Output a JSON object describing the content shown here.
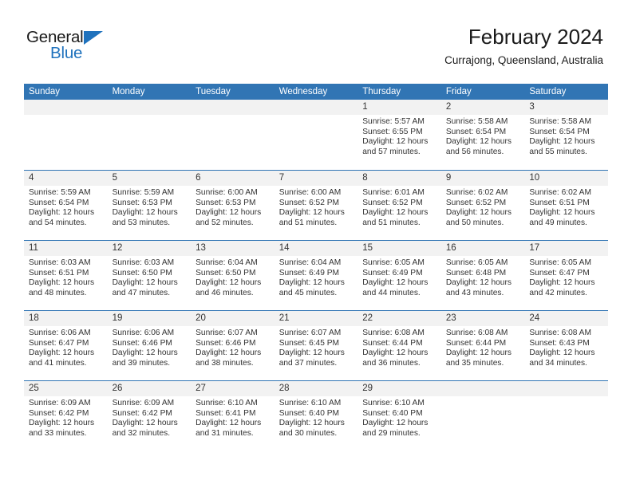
{
  "brand": {
    "name_top": "General",
    "name_bottom": "Blue"
  },
  "header": {
    "title": "February 2024",
    "subtitle": "Currajong, Queensland, Australia"
  },
  "colors": {
    "header_blue": "#3175b4",
    "brand_blue": "#1f72bd",
    "day_band_gray": "#f2f2f2",
    "text": "#333333"
  },
  "calendar": {
    "weekday_headers": [
      "Sunday",
      "Monday",
      "Tuesday",
      "Wednesday",
      "Thursday",
      "Friday",
      "Saturday"
    ],
    "weeks": [
      [
        {
          "day": "",
          "empty": true
        },
        {
          "day": "",
          "empty": true
        },
        {
          "day": "",
          "empty": true
        },
        {
          "day": "",
          "empty": true
        },
        {
          "day": "1",
          "sunrise": "Sunrise: 5:57 AM",
          "sunset": "Sunset: 6:55 PM",
          "daylight_1": "Daylight: 12 hours",
          "daylight_2": "and 57 minutes."
        },
        {
          "day": "2",
          "sunrise": "Sunrise: 5:58 AM",
          "sunset": "Sunset: 6:54 PM",
          "daylight_1": "Daylight: 12 hours",
          "daylight_2": "and 56 minutes."
        },
        {
          "day": "3",
          "sunrise": "Sunrise: 5:58 AM",
          "sunset": "Sunset: 6:54 PM",
          "daylight_1": "Daylight: 12 hours",
          "daylight_2": "and 55 minutes."
        }
      ],
      [
        {
          "day": "4",
          "sunrise": "Sunrise: 5:59 AM",
          "sunset": "Sunset: 6:54 PM",
          "daylight_1": "Daylight: 12 hours",
          "daylight_2": "and 54 minutes."
        },
        {
          "day": "5",
          "sunrise": "Sunrise: 5:59 AM",
          "sunset": "Sunset: 6:53 PM",
          "daylight_1": "Daylight: 12 hours",
          "daylight_2": "and 53 minutes."
        },
        {
          "day": "6",
          "sunrise": "Sunrise: 6:00 AM",
          "sunset": "Sunset: 6:53 PM",
          "daylight_1": "Daylight: 12 hours",
          "daylight_2": "and 52 minutes."
        },
        {
          "day": "7",
          "sunrise": "Sunrise: 6:00 AM",
          "sunset": "Sunset: 6:52 PM",
          "daylight_1": "Daylight: 12 hours",
          "daylight_2": "and 51 minutes."
        },
        {
          "day": "8",
          "sunrise": "Sunrise: 6:01 AM",
          "sunset": "Sunset: 6:52 PM",
          "daylight_1": "Daylight: 12 hours",
          "daylight_2": "and 51 minutes."
        },
        {
          "day": "9",
          "sunrise": "Sunrise: 6:02 AM",
          "sunset": "Sunset: 6:52 PM",
          "daylight_1": "Daylight: 12 hours",
          "daylight_2": "and 50 minutes."
        },
        {
          "day": "10",
          "sunrise": "Sunrise: 6:02 AM",
          "sunset": "Sunset: 6:51 PM",
          "daylight_1": "Daylight: 12 hours",
          "daylight_2": "and 49 minutes."
        }
      ],
      [
        {
          "day": "11",
          "sunrise": "Sunrise: 6:03 AM",
          "sunset": "Sunset: 6:51 PM",
          "daylight_1": "Daylight: 12 hours",
          "daylight_2": "and 48 minutes."
        },
        {
          "day": "12",
          "sunrise": "Sunrise: 6:03 AM",
          "sunset": "Sunset: 6:50 PM",
          "daylight_1": "Daylight: 12 hours",
          "daylight_2": "and 47 minutes."
        },
        {
          "day": "13",
          "sunrise": "Sunrise: 6:04 AM",
          "sunset": "Sunset: 6:50 PM",
          "daylight_1": "Daylight: 12 hours",
          "daylight_2": "and 46 minutes."
        },
        {
          "day": "14",
          "sunrise": "Sunrise: 6:04 AM",
          "sunset": "Sunset: 6:49 PM",
          "daylight_1": "Daylight: 12 hours",
          "daylight_2": "and 45 minutes."
        },
        {
          "day": "15",
          "sunrise": "Sunrise: 6:05 AM",
          "sunset": "Sunset: 6:49 PM",
          "daylight_1": "Daylight: 12 hours",
          "daylight_2": "and 44 minutes."
        },
        {
          "day": "16",
          "sunrise": "Sunrise: 6:05 AM",
          "sunset": "Sunset: 6:48 PM",
          "daylight_1": "Daylight: 12 hours",
          "daylight_2": "and 43 minutes."
        },
        {
          "day": "17",
          "sunrise": "Sunrise: 6:05 AM",
          "sunset": "Sunset: 6:47 PM",
          "daylight_1": "Daylight: 12 hours",
          "daylight_2": "and 42 minutes."
        }
      ],
      [
        {
          "day": "18",
          "sunrise": "Sunrise: 6:06 AM",
          "sunset": "Sunset: 6:47 PM",
          "daylight_1": "Daylight: 12 hours",
          "daylight_2": "and 41 minutes."
        },
        {
          "day": "19",
          "sunrise": "Sunrise: 6:06 AM",
          "sunset": "Sunset: 6:46 PM",
          "daylight_1": "Daylight: 12 hours",
          "daylight_2": "and 39 minutes."
        },
        {
          "day": "20",
          "sunrise": "Sunrise: 6:07 AM",
          "sunset": "Sunset: 6:46 PM",
          "daylight_1": "Daylight: 12 hours",
          "daylight_2": "and 38 minutes."
        },
        {
          "day": "21",
          "sunrise": "Sunrise: 6:07 AM",
          "sunset": "Sunset: 6:45 PM",
          "daylight_1": "Daylight: 12 hours",
          "daylight_2": "and 37 minutes."
        },
        {
          "day": "22",
          "sunrise": "Sunrise: 6:08 AM",
          "sunset": "Sunset: 6:44 PM",
          "daylight_1": "Daylight: 12 hours",
          "daylight_2": "and 36 minutes."
        },
        {
          "day": "23",
          "sunrise": "Sunrise: 6:08 AM",
          "sunset": "Sunset: 6:44 PM",
          "daylight_1": "Daylight: 12 hours",
          "daylight_2": "and 35 minutes."
        },
        {
          "day": "24",
          "sunrise": "Sunrise: 6:08 AM",
          "sunset": "Sunset: 6:43 PM",
          "daylight_1": "Daylight: 12 hours",
          "daylight_2": "and 34 minutes."
        }
      ],
      [
        {
          "day": "25",
          "sunrise": "Sunrise: 6:09 AM",
          "sunset": "Sunset: 6:42 PM",
          "daylight_1": "Daylight: 12 hours",
          "daylight_2": "and 33 minutes."
        },
        {
          "day": "26",
          "sunrise": "Sunrise: 6:09 AM",
          "sunset": "Sunset: 6:42 PM",
          "daylight_1": "Daylight: 12 hours",
          "daylight_2": "and 32 minutes."
        },
        {
          "day": "27",
          "sunrise": "Sunrise: 6:10 AM",
          "sunset": "Sunset: 6:41 PM",
          "daylight_1": "Daylight: 12 hours",
          "daylight_2": "and 31 minutes."
        },
        {
          "day": "28",
          "sunrise": "Sunrise: 6:10 AM",
          "sunset": "Sunset: 6:40 PM",
          "daylight_1": "Daylight: 12 hours",
          "daylight_2": "and 30 minutes."
        },
        {
          "day": "29",
          "sunrise": "Sunrise: 6:10 AM",
          "sunset": "Sunset: 6:40 PM",
          "daylight_1": "Daylight: 12 hours",
          "daylight_2": "and 29 minutes."
        },
        {
          "day": "",
          "empty": true
        },
        {
          "day": "",
          "empty": true
        }
      ]
    ]
  }
}
